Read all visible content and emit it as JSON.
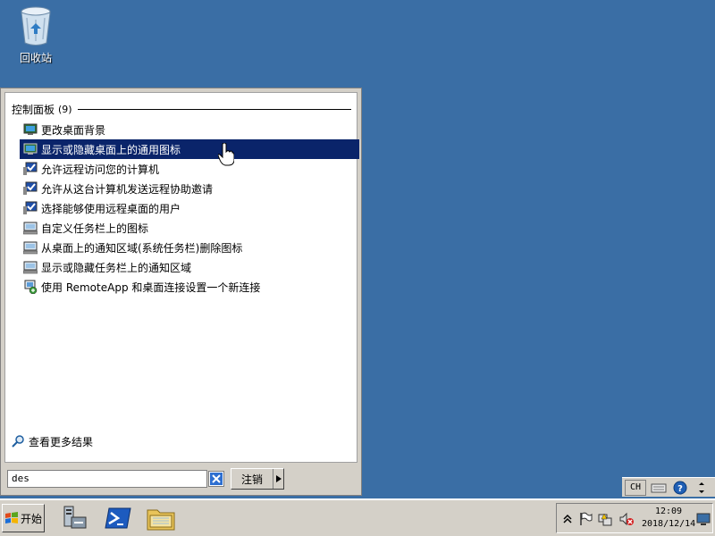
{
  "desktop": {
    "recycle_bin_label": "回收站"
  },
  "start_menu": {
    "section_title": "控制面板",
    "section_count": "(9)",
    "results": [
      {
        "label": "更改桌面背景",
        "icon": "display-icon",
        "selected": false
      },
      {
        "label": "显示或隐藏桌面上的通用图标",
        "icon": "display-icon",
        "selected": true
      },
      {
        "label": "允许远程访问您的计算机",
        "icon": "system-check-icon",
        "selected": false
      },
      {
        "label": "允许从这台计算机发送远程协助邀请",
        "icon": "system-check-icon",
        "selected": false
      },
      {
        "label": "选择能够使用远程桌面的用户",
        "icon": "system-check-icon",
        "selected": false
      },
      {
        "label": "自定义任务栏上的图标",
        "icon": "computer-icon",
        "selected": false
      },
      {
        "label": "从桌面上的通知区域(系统任务栏)删除图标",
        "icon": "computer-icon",
        "selected": false
      },
      {
        "label": "显示或隐藏任务栏上的通知区域",
        "icon": "computer-icon",
        "selected": false
      },
      {
        "label": "使用 RemoteApp 和桌面连接设置一个新连接",
        "icon": "remoteapp-icon",
        "selected": false
      }
    ],
    "more_results": "查看更多结果",
    "search_value": "des",
    "logoff_label": "注销"
  },
  "language_bar": {
    "lang": "CH"
  },
  "taskbar": {
    "start_label": "开始",
    "clock_time": "12:09",
    "clock_date": "2018/12/14"
  },
  "colors": {
    "desktop": "#3a6ea5",
    "selection": "#0a246a",
    "chrome": "#d4d0c8"
  }
}
